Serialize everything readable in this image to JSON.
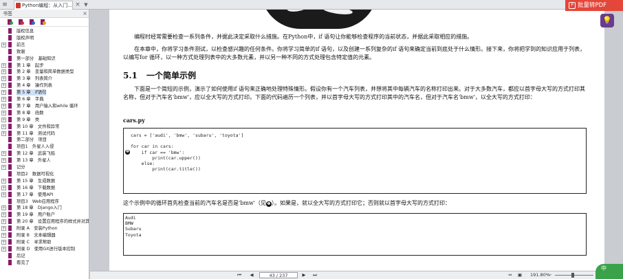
{
  "tabbar": {
    "doc_tab_label": "Python编程：从入门...",
    "close_glyph": "×",
    "arrow_glyph": "▼"
  },
  "sidebar": {
    "title": "书签",
    "close_glyph": "×",
    "items": [
      {
        "label": "版权信息",
        "expandable": false
      },
      {
        "label": "版权声明",
        "expandable": false
      },
      {
        "label": "前言",
        "expandable": true
      },
      {
        "label": "致谢",
        "expandable": false
      },
      {
        "label": "第一部分　基础知识",
        "expandable": false
      },
      {
        "label": "第 1 章　起步",
        "expandable": true
      },
      {
        "label": "第 2 章　变量和简单数据类型",
        "expandable": true
      },
      {
        "label": "第 3 章　列表简介",
        "expandable": true
      },
      {
        "label": "第 4 章　操作列表",
        "expandable": true
      },
      {
        "label": "第 5 章　if语句",
        "expandable": true,
        "selected": true
      },
      {
        "label": "第 6 章　字典",
        "expandable": true
      },
      {
        "label": "第 7 章　用户输入和while 循环",
        "expandable": true
      },
      {
        "label": "第 8 章　函数",
        "expandable": true
      },
      {
        "label": "第 9 章　类",
        "expandable": true
      },
      {
        "label": "第 10 章　文件和异常",
        "expandable": true
      },
      {
        "label": "第 11 章　测试代码",
        "expandable": true
      },
      {
        "label": "第二部分　项目",
        "expandable": false
      },
      {
        "label": "项目1　外星人入侵",
        "expandable": false
      },
      {
        "label": "第 12 章　武装飞船",
        "expandable": true
      },
      {
        "label": "第 13 章　外星人",
        "expandable": true
      },
      {
        "label": "记分",
        "expandable": true
      },
      {
        "label": "项目2　数据可视化",
        "expandable": false
      },
      {
        "label": "第 15 章　生成数据",
        "expandable": true
      },
      {
        "label": "第 16 章　下载数据",
        "expandable": true
      },
      {
        "label": "第 17 章　使用API",
        "expandable": true
      },
      {
        "label": "项目3　Web应用程序",
        "expandable": false
      },
      {
        "label": "第 18 章　Django入门",
        "expandable": true
      },
      {
        "label": "第 19 章　用户账户",
        "expandable": true
      },
      {
        "label": "第 20 章　设置应用程序的样式并对其...",
        "expandable": true
      },
      {
        "label": "附录 A　安装Python",
        "expandable": true
      },
      {
        "label": "附录 B　文本编辑器",
        "expandable": true
      },
      {
        "label": "附录 C　寻求帮助",
        "expandable": true
      },
      {
        "label": "附录 D　使用Git进行版本控制",
        "expandable": true
      },
      {
        "label": "后记",
        "expandable": false
      },
      {
        "label": "看完了",
        "expandable": false
      }
    ]
  },
  "document": {
    "p1": "编程时经常需要检查一系列条件，并据此决定采取什么措施。在Python中，if 语句让你能够检查程序的当前状态，并据此采取相应的措施。",
    "p2": "在本章中，你将学习条件测试，以检查感兴趣的任何条件。你将学习简单的if 语句，以及创建一系列复杂的if 语句来确定当前到底处于什么情形。接下来，你将把学到的知识应用于列表，以编写for 循环，以一种方式处理列表中的大多数元素，并以另一种不同的方式处理包含特定值的元素。",
    "section_number": "5.1",
    "section_title": "一个简单示例",
    "p3": "下面是一个简短的示例，演示了如何使用if 语句来正确地处理特殊情形。假设你有一个汽车列表，并想将其中每辆汽车的名称打印出来。对于大多数汽车，都应以首字母大写的方式打印其名称，但对于汽车名'bmw'，应以全大写的方式打印。下面的代码遍历一个列表，并以首字母大写的方式打印其中的汽车名，但对于汽车名'bmw'，以全大写的方式打印：",
    "code_title": "cars.py",
    "code_lines": [
      "cars = ['audi', 'bmw', 'subaru', 'toyota']",
      "",
      "for car in cars:",
      "    if car == 'bmw':",
      "        print(car.upper())",
      "    else:",
      "        print(car.title())"
    ],
    "code_marker": "❶",
    "p4_before": "这个示例中的循环首先检查当前的汽车名是否是'bmw'（见",
    "p4_marker": "❶",
    "p4_after": "）。如果是，就以全大写的方式打印它；否则就以首字母大写的方式打印：",
    "output_lines": [
      "Audi",
      "BMW",
      "Subaru",
      "Toyota"
    ]
  },
  "overlays": {
    "pdf_banner": "批量转PDF",
    "pdf_banner_icon": "P",
    "bulb_glyph": "💡"
  },
  "statusbar": {
    "first": "⏮",
    "prev": "◀",
    "page": "43 / 237",
    "next": "▶",
    "last": "⏭",
    "zoom": "191.80%",
    "zoom_out": "−",
    "zoom_in": "+"
  },
  "corner_badge": "中"
}
